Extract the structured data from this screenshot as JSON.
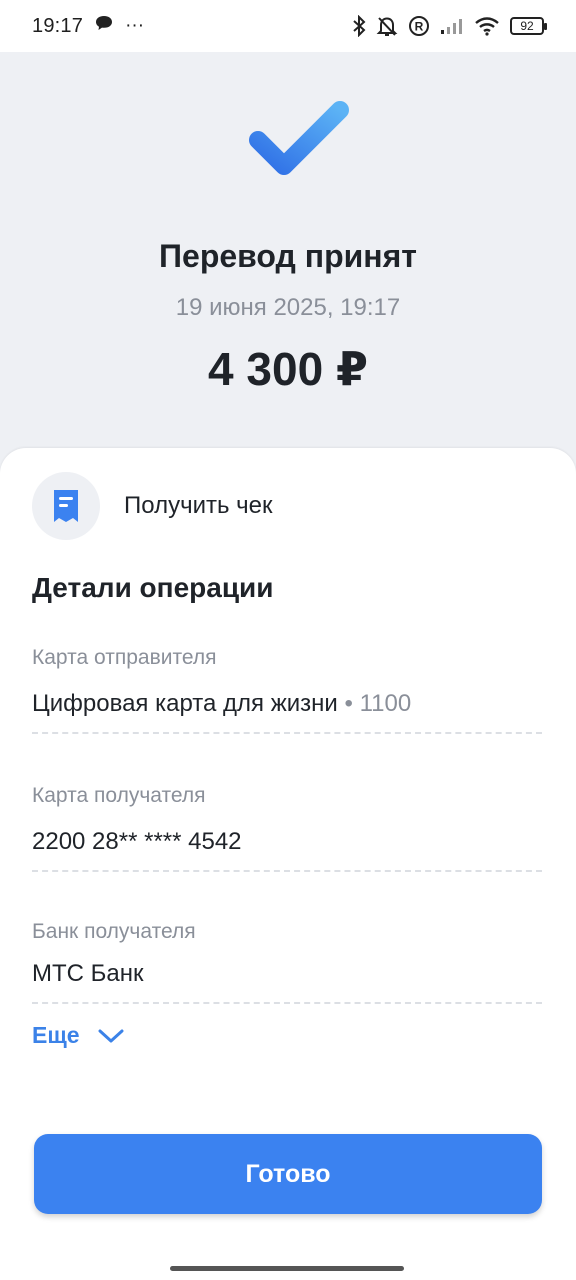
{
  "status_bar": {
    "time": "19:17",
    "dots": "···",
    "battery": "92",
    "icons": [
      "chat-bubble-icon",
      "bluetooth-icon",
      "bell-off-icon",
      "registered-icon",
      "signal-icon",
      "wifi-icon",
      "battery-icon"
    ]
  },
  "header": {
    "check_icon": "checkmark-icon",
    "title": "Перевод принят",
    "date": "19 июня 2025, 19:17",
    "amount": "4 300 ₽"
  },
  "receipt": {
    "icon": "receipt-icon",
    "label": "Получить чек"
  },
  "details": {
    "title": "Детали операции",
    "sender_card": {
      "label": "Карта отправителя",
      "value": "Цифровая карта для жизни",
      "suffix": "• 1100"
    },
    "recipient_card": {
      "label": "Карта получателя",
      "value": "2200 28** **** 4542"
    },
    "recipient_bank": {
      "label": "Банк получателя",
      "value": "МТС Банк"
    },
    "more_label": "Еще",
    "more_icon": "chevron-down-icon"
  },
  "actions": {
    "done_label": "Готово"
  },
  "colors": {
    "accent": "#3b82f0",
    "background": "#eef0f4",
    "muted_text": "#8a8f99"
  }
}
